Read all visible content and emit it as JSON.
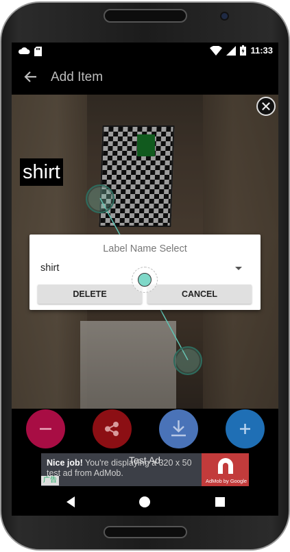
{
  "status_bar": {
    "time": "11:33",
    "icons_left": [
      "cloud-icon",
      "sd-card-icon"
    ],
    "icons_right": [
      "wifi-icon",
      "signal-icon",
      "battery-icon"
    ]
  },
  "app_bar": {
    "title": "Add Item"
  },
  "photo": {
    "label": "shirt"
  },
  "dialog": {
    "title": "Label Name Select",
    "selected_value": "shirt",
    "delete_label": "DELETE",
    "cancel_label": "CANCEL"
  },
  "actions": {
    "remove_symbol": "−",
    "add_symbol": "+"
  },
  "ad": {
    "test_label": "Test Ad",
    "headline": "Nice job!",
    "body": " You're displaying a 320 x 50 test ad from AdMob.",
    "admob_label": "AdMob by Google",
    "choices_label": "广告"
  },
  "colors": {
    "remove": "#a80d44",
    "share": "#8c0f14",
    "download": "#4a73b8",
    "add": "#1f6fb5",
    "handle": "#7fd8c8",
    "line": "#5fc4b4"
  }
}
